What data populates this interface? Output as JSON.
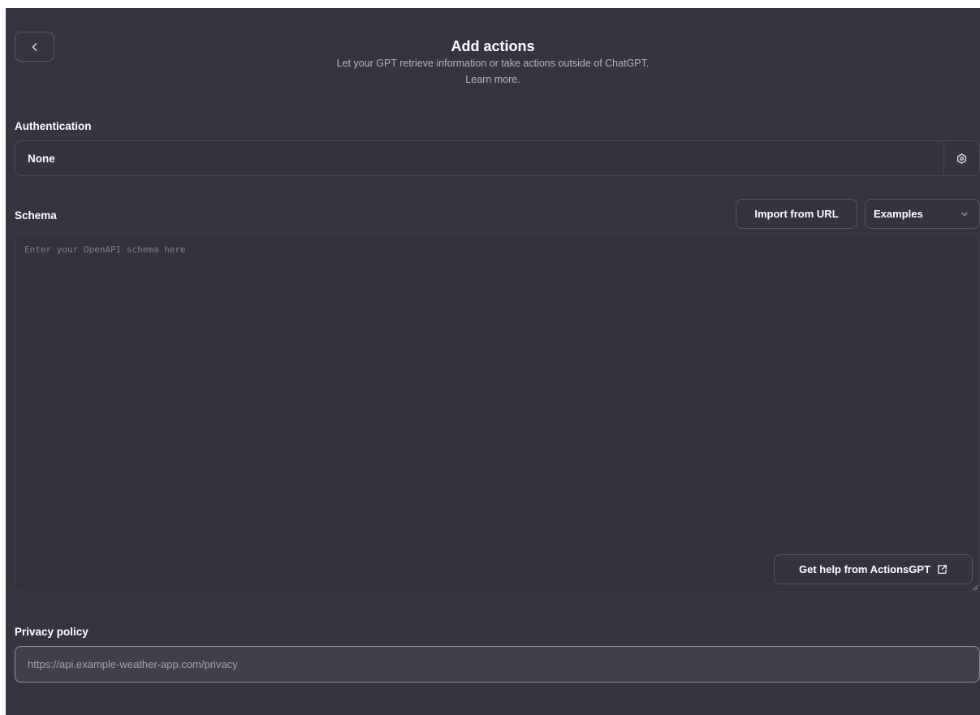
{
  "header": {
    "title": "Add actions",
    "subtitle": "Let your GPT retrieve information or take actions outside of ChatGPT.",
    "learn_more": "Learn more."
  },
  "authentication": {
    "label": "Authentication",
    "value": "None"
  },
  "schema": {
    "label": "Schema",
    "import_button": "Import from URL",
    "examples_button": "Examples",
    "placeholder": "Enter your OpenAPI schema here",
    "help_button": "Get help from ActionsGPT"
  },
  "privacy": {
    "label": "Privacy policy",
    "placeholder": "https://api.example-weather-app.com/privacy"
  },
  "icons": {
    "back": "chevron-left-icon",
    "settings": "gear-icon",
    "dropdown": "chevron-down-icon",
    "external": "external-link-icon"
  },
  "colors": {
    "background": "#353440",
    "text": "#ffffff",
    "muted_text": "#b4b4bd",
    "border": "#565662"
  }
}
